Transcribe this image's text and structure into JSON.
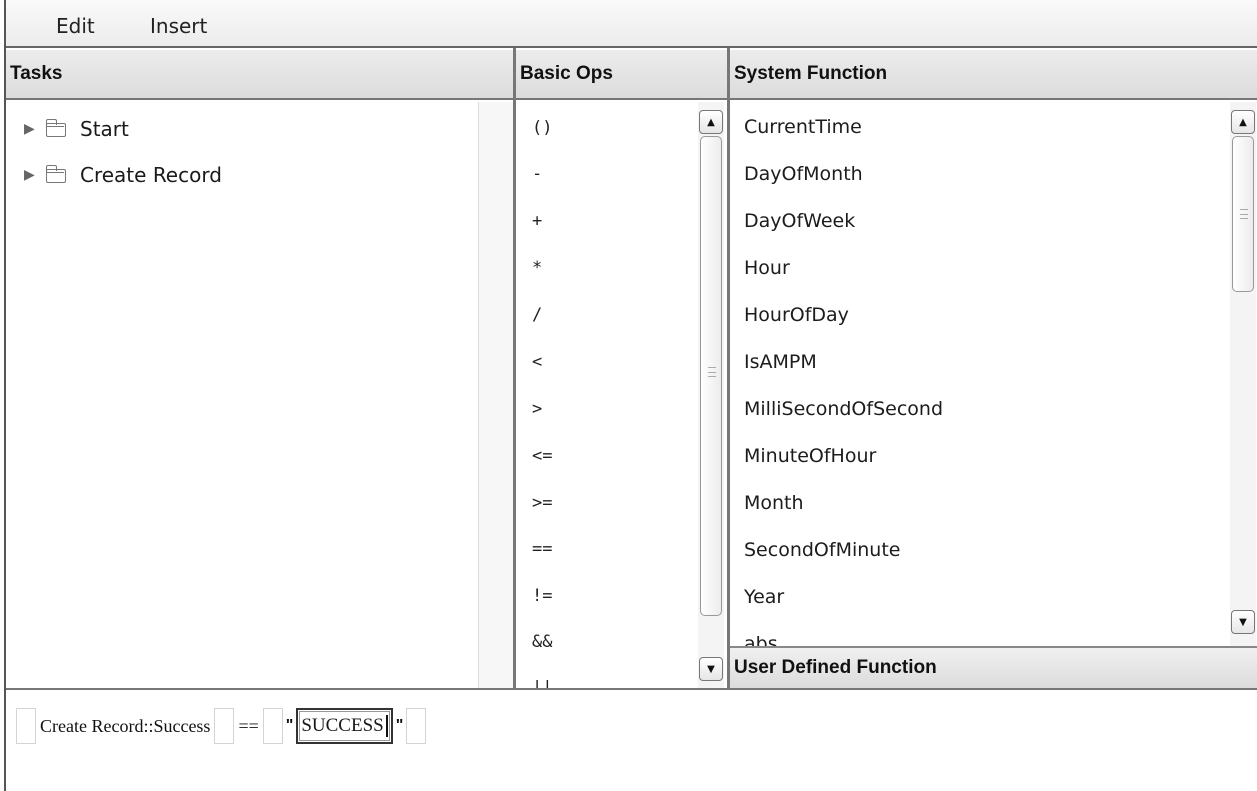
{
  "menubar": {
    "edit": "Edit",
    "insert": "Insert"
  },
  "tasks": {
    "header": "Tasks",
    "items": [
      {
        "label": "Start"
      },
      {
        "label": "Create Record"
      }
    ]
  },
  "basic_ops": {
    "header": "Basic Ops",
    "items": [
      "()",
      "-",
      "+",
      "*",
      "/",
      "<",
      ">",
      "<=",
      ">=",
      "==",
      "!=",
      "&&",
      "||"
    ]
  },
  "system_function": {
    "header": "System Function",
    "items": [
      "CurrentTime",
      "DayOfMonth",
      "DayOfWeek",
      "Hour",
      "HourOfDay",
      "IsAMPM",
      "MilliSecondOfSecond",
      "MinuteOfHour",
      "Month",
      "SecondOfMinute",
      "Year",
      "abs"
    ]
  },
  "user_defined_function": {
    "header": "User Defined Function"
  },
  "expression": {
    "task_ref": "Create Record::Success",
    "operator": "==",
    "open_quote": "\"",
    "value": "SUCCESS",
    "close_quote": "\""
  },
  "icons": {
    "tree_expander": "triangle-right-icon",
    "tree_folder": "folder-icon",
    "scroll_up": "arrow-up-icon",
    "scroll_down": "arrow-down-icon"
  }
}
